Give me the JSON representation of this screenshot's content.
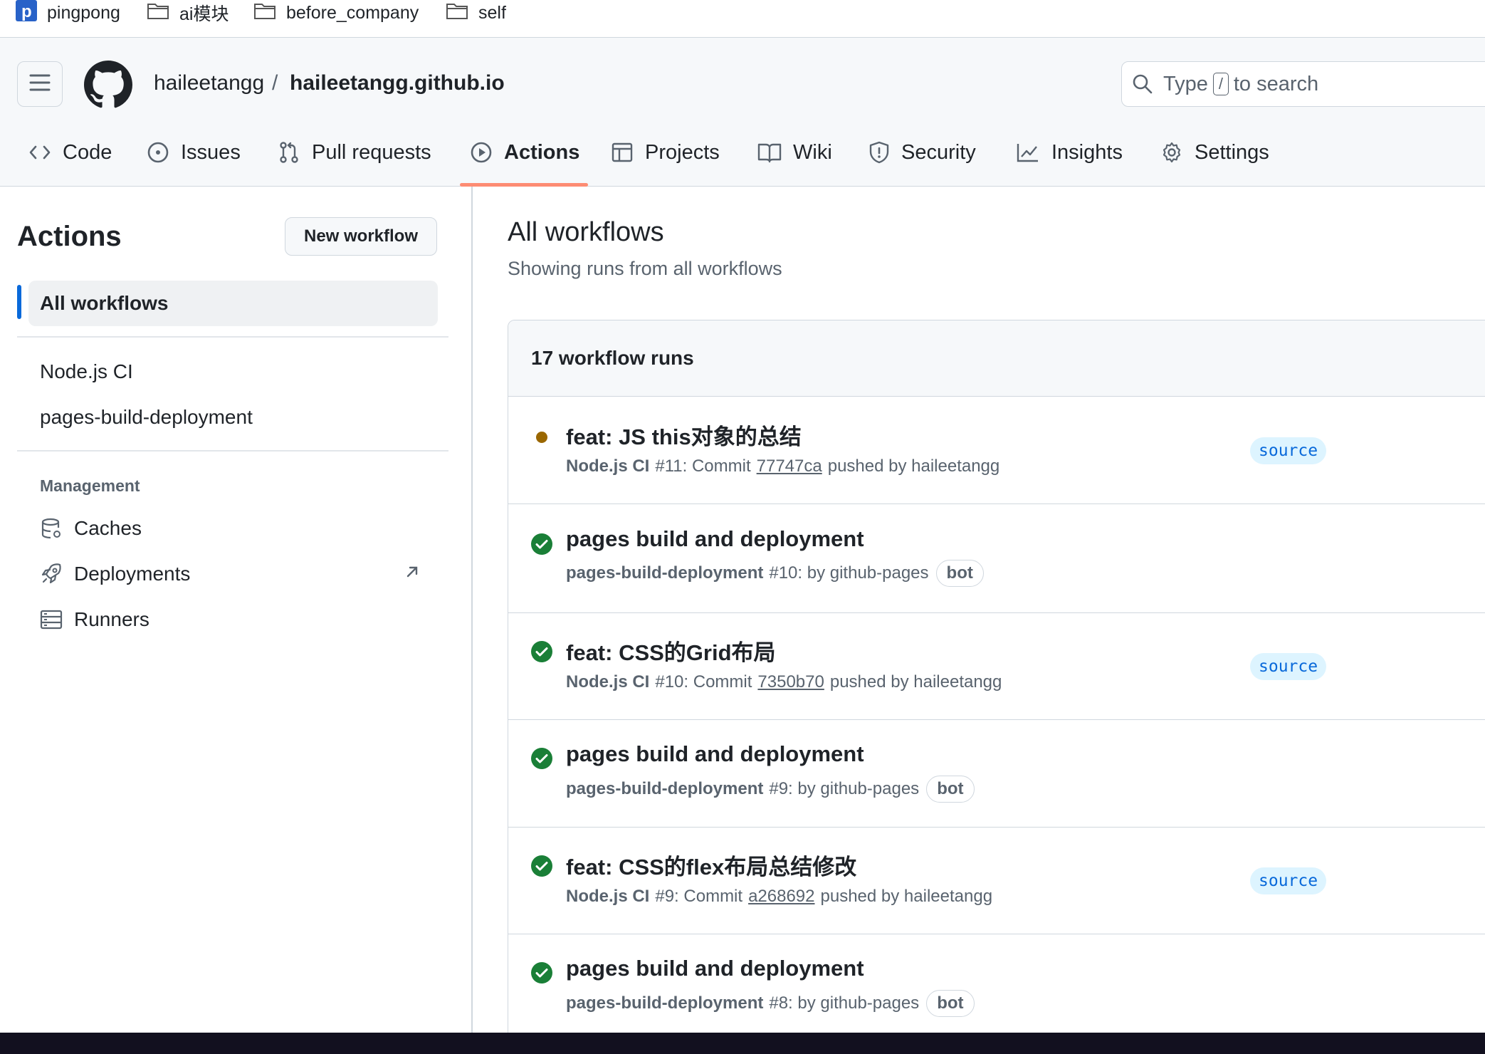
{
  "bookmarks": [
    {
      "label": "pingpong",
      "icon": "pingpong-favicon-icon"
    },
    {
      "label": "ai模块",
      "icon": "folder-icon"
    },
    {
      "label": "before_company",
      "icon": "folder-icon"
    },
    {
      "label": "self",
      "icon": "folder-icon"
    }
  ],
  "repo": {
    "owner": "haileetangg",
    "separator": "/",
    "name": "haileetangg.github.io"
  },
  "search": {
    "prefix": "Type",
    "key": "/",
    "suffix": "to search"
  },
  "tabs": [
    {
      "label": "Code",
      "icon": "code-icon"
    },
    {
      "label": "Issues",
      "icon": "issue-icon"
    },
    {
      "label": "Pull requests",
      "icon": "pull-request-icon"
    },
    {
      "label": "Actions",
      "icon": "play-icon",
      "selected": true
    },
    {
      "label": "Projects",
      "icon": "table-icon"
    },
    {
      "label": "Wiki",
      "icon": "book-icon"
    },
    {
      "label": "Security",
      "icon": "shield-icon"
    },
    {
      "label": "Insights",
      "icon": "graph-icon"
    },
    {
      "label": "Settings",
      "icon": "gear-icon"
    }
  ],
  "sidebar": {
    "title": "Actions",
    "new_workflow": "New workflow",
    "all_workflows": "All workflows",
    "workflows": [
      "Node.js CI",
      "pages-build-deployment"
    ],
    "management_heading": "Management",
    "management": [
      {
        "label": "Caches",
        "icon": "database-icon"
      },
      {
        "label": "Deployments",
        "icon": "rocket-icon",
        "external": true
      },
      {
        "label": "Runners",
        "icon": "server-icon"
      }
    ]
  },
  "main": {
    "title": "All workflows",
    "subtitle": "Showing runs from all workflows",
    "runs_count": "17 workflow runs",
    "runs": [
      {
        "status": "in_progress",
        "title": "feat: JS this对象的总结",
        "workflow": "Node.js CI",
        "meta": "#11: Commit",
        "sha": "77747ca",
        "tail": "pushed by haileetangg",
        "tag": "source"
      },
      {
        "status": "success",
        "title": "pages build and deployment",
        "workflow": "pages-build-deployment",
        "meta": "#10: by github-pages",
        "bot": "bot"
      },
      {
        "status": "success",
        "title": "feat: CSS的Grid布局",
        "workflow": "Node.js CI",
        "meta": "#10: Commit",
        "sha": "7350b70",
        "tail": "pushed by haileetangg",
        "tag": "source"
      },
      {
        "status": "success",
        "title": "pages build and deployment",
        "workflow": "pages-build-deployment",
        "meta": "#9: by github-pages",
        "bot": "bot"
      },
      {
        "status": "success",
        "title": "feat: CSS的flex布局总结修改",
        "workflow": "Node.js CI",
        "meta": "#9: Commit",
        "sha": "a268692",
        "tail": "pushed by haileetangg",
        "tag": "source"
      },
      {
        "status": "success",
        "title": "pages build and deployment",
        "workflow": "pages-build-deployment",
        "meta": "#8: by github-pages",
        "bot": "bot"
      }
    ]
  },
  "colors": {
    "success": "#1a7f37",
    "in_progress": "#9a6700",
    "accent": "#0969da",
    "tab_underline": "#fd8c73"
  }
}
